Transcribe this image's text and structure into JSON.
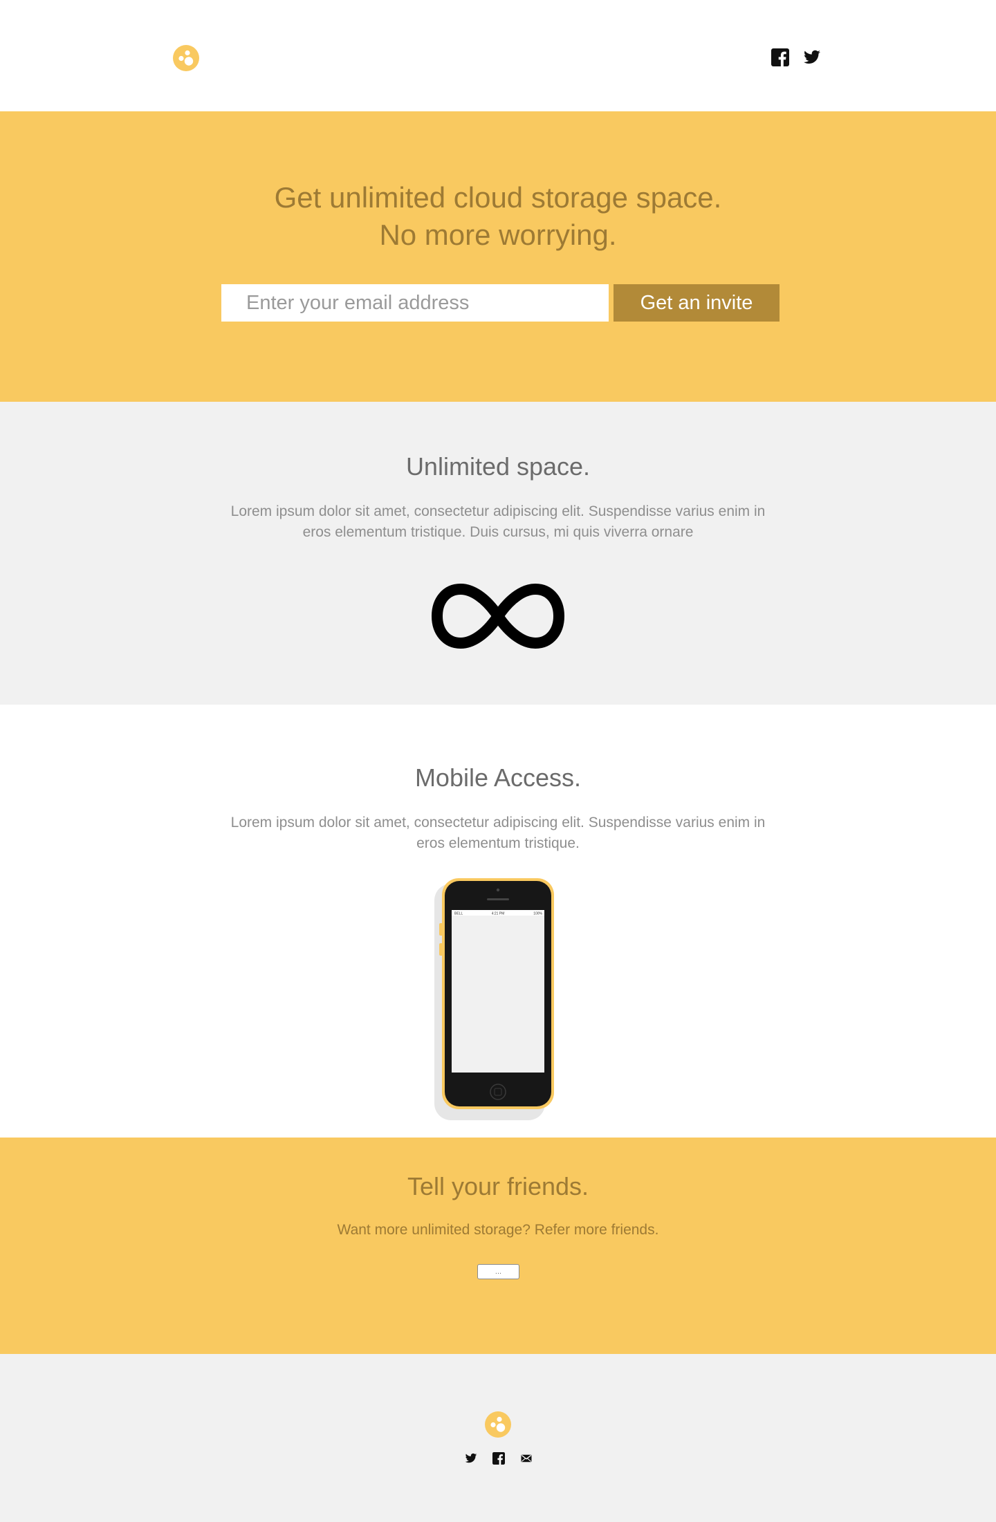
{
  "header": {
    "logo_icon": "logo-circle-icon",
    "social": [
      "facebook-icon",
      "twitter-icon"
    ]
  },
  "hero": {
    "title_line1": "Get unlimited cloud storage space.",
    "title_line2": "No more worrying.",
    "email_placeholder": "Enter your email address",
    "invite_label": "Get an invite"
  },
  "unlimited": {
    "title": "Unlimited space.",
    "body": "Lorem ipsum dolor sit amet, consectetur adipiscing elit. Suspendisse varius enim in eros elementum tristique. Duis cursus, mi quis viverra ornare",
    "icon": "infinity-icon"
  },
  "mobile": {
    "title": "Mobile Access.",
    "body": "Lorem ipsum dolor sit amet, consectetur adipiscing elit. Suspendisse varius enim in eros elementum tristique.",
    "status_carrier": "BELL",
    "status_time": "4:21 PM",
    "status_battery": "100%"
  },
  "friends": {
    "title": "Tell your friends.",
    "body": "Want more unlimited storage? Refer more friends.",
    "share_label": "..."
  },
  "footer": {
    "logo_icon": "logo-circle-icon",
    "social": [
      "twitter-icon",
      "facebook-icon",
      "mail-icon"
    ]
  },
  "colors": {
    "brand_yellow": "#f9c960",
    "brand_dark_gold": "#b28a38",
    "text_gold": "#9d7a34",
    "light_gray": "#f1f1f1"
  }
}
